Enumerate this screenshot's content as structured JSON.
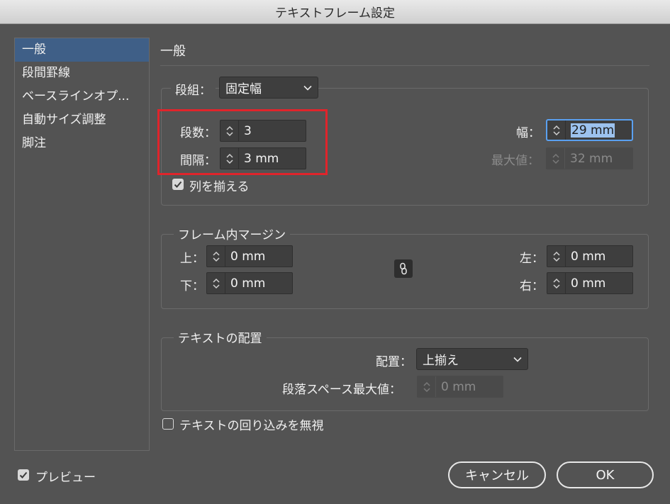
{
  "window": {
    "title": "テキストフレーム設定"
  },
  "sidebar": {
    "items": [
      {
        "label": "一般"
      },
      {
        "label": "段間罫線"
      },
      {
        "label": "ベースラインオプ..."
      },
      {
        "label": "自動サイズ調整"
      },
      {
        "label": "脚注"
      }
    ],
    "selected": "一般"
  },
  "main": {
    "title": "一般",
    "columns": {
      "legend_label": "段組：",
      "mode_value": "固定幅",
      "count_label": "段数：",
      "count_value": "3",
      "gutter_label": "間隔：",
      "gutter_value": "3 mm",
      "width_label": "幅：",
      "width_value": "29 mm",
      "max_label": "最大値：",
      "max_value": "32 mm",
      "balance_label": "列を揃える",
      "balance_checked": true
    },
    "inset": {
      "legend": "フレーム内マージン",
      "top_label": "上：",
      "top_value": "0 mm",
      "bottom_label": "下：",
      "bottom_value": "0 mm",
      "left_label": "左：",
      "left_value": "0 mm",
      "right_label": "右：",
      "right_value": "0 mm"
    },
    "vertical": {
      "legend": "テキストの配置",
      "align_label": "配置：",
      "align_value": "上揃え",
      "spacing_label": "段落スペース最大値：",
      "spacing_value": "0 mm"
    },
    "ignore_wrap_label": "テキストの回り込みを無視",
    "ignore_wrap_checked": false
  },
  "footer": {
    "preview_label": "プレビュー",
    "preview_checked": true,
    "cancel_label": "キャンセル",
    "ok_label": "OK"
  },
  "colors": {
    "background": "#535353",
    "selection": "#3f5f87",
    "highlight_box": "#e0242b",
    "focus_ring": "#5aa0f0"
  }
}
